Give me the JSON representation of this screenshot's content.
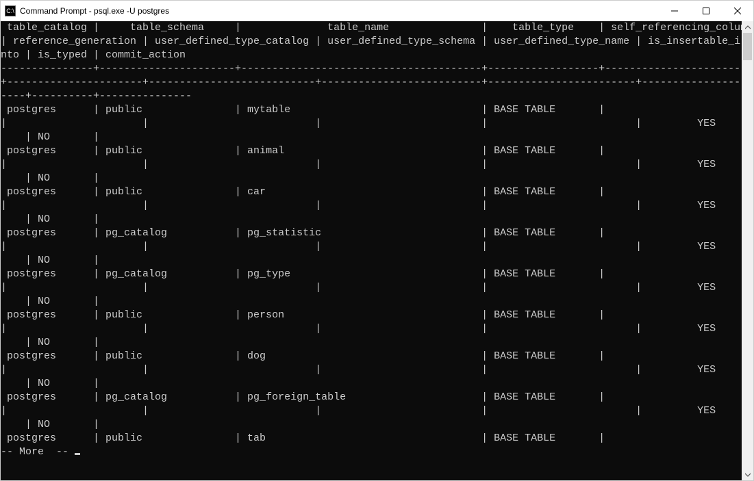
{
  "window": {
    "title": "Command Prompt - psql.exe  -U postgres",
    "icon_label": "C:\\"
  },
  "headers_line1": " table_catalog |     table_schema     |              table_name               |    table_type    | self_referencing_column_name ",
  "headers_line2": "| reference_generation | user_defined_type_catalog | user_defined_type_schema | user_defined_type_name | is_insertable_i",
  "headers_line3": "nto | is_typed | commit_action",
  "separator_top": "---------------+----------------------+---------------------------------------+------------------+------------------------------",
  "separator_mid": "+----------------------+---------------------------+--------------------------+------------------------+----------------",
  "separator_bot": "----+----------+---------------",
  "rows": [
    {
      "catalog": "postgres",
      "schema": "public",
      "name": "mytable",
      "type": "BASE TABLE",
      "insertable": "YES",
      "typed": "NO"
    },
    {
      "catalog": "postgres",
      "schema": "public",
      "name": "animal",
      "type": "BASE TABLE",
      "insertable": "YES",
      "typed": "NO"
    },
    {
      "catalog": "postgres",
      "schema": "public",
      "name": "car",
      "type": "BASE TABLE",
      "insertable": "YES",
      "typed": "NO"
    },
    {
      "catalog": "postgres",
      "schema": "pg_catalog",
      "name": "pg_statistic",
      "type": "BASE TABLE",
      "insertable": "YES",
      "typed": "NO"
    },
    {
      "catalog": "postgres",
      "schema": "pg_catalog",
      "name": "pg_type",
      "type": "BASE TABLE",
      "insertable": "YES",
      "typed": "NO"
    },
    {
      "catalog": "postgres",
      "schema": "public",
      "name": "person",
      "type": "BASE TABLE",
      "insertable": "YES",
      "typed": "NO"
    },
    {
      "catalog": "postgres",
      "schema": "public",
      "name": "dog",
      "type": "BASE TABLE",
      "insertable": "YES",
      "typed": "NO"
    },
    {
      "catalog": "postgres",
      "schema": "pg_catalog",
      "name": "pg_foreign_table",
      "type": "BASE TABLE",
      "insertable": "YES",
      "typed": "NO"
    }
  ],
  "last_row": {
    "catalog": "postgres",
    "schema": "public",
    "name": "tab",
    "type": "BASE TABLE"
  },
  "more_prompt": "-- More  -- ",
  "col_widths": {
    "catalog": 15,
    "schema": 22,
    "name": 39,
    "type": 18,
    "refcol": 30,
    "refgen": 22,
    "udtc": 27,
    "udts": 26,
    "udtn": 24,
    "insert_prefix": 9,
    "insert_total": 20,
    "typed": 10,
    "commit": 15
  }
}
